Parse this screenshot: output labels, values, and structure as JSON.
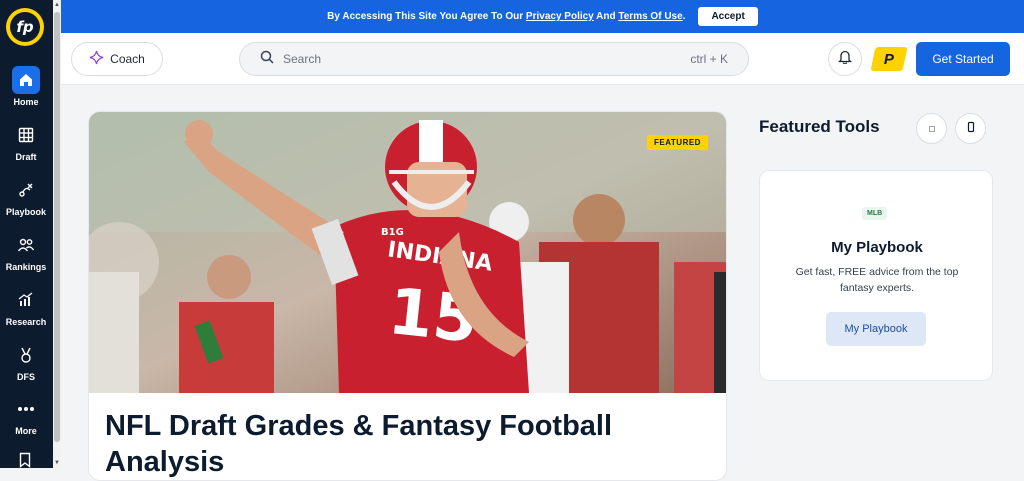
{
  "sidebar": {
    "logo_text": "fp",
    "items": [
      {
        "label": "Home",
        "icon": "home-icon",
        "active": true
      },
      {
        "label": "Draft",
        "icon": "grid-icon"
      },
      {
        "label": "Playbook",
        "icon": "playbook-icon"
      },
      {
        "label": "Rankings",
        "icon": "users-icon"
      },
      {
        "label": "Research",
        "icon": "chart-icon"
      },
      {
        "label": "DFS",
        "icon": "medal-icon"
      },
      {
        "label": "More",
        "icon": "dots-icon"
      }
    ]
  },
  "banner": {
    "text_prefix": "By Accessing This Site You Agree To Our ",
    "privacy_link": "Privacy Policy",
    "text_middle": " And ",
    "terms_link": "Terms Of Use",
    "text_suffix": ".",
    "accept_label": "Accept"
  },
  "header": {
    "coach_label": "Coach",
    "search_placeholder": "Search",
    "search_shortcut": "ctrl + K",
    "premium_badge": "P",
    "get_started_label": "Get Started"
  },
  "article": {
    "badge": "FEATURED",
    "title": "NFL Draft Grades & Fantasy Football Analysis",
    "jersey_text": "INDIANA",
    "jersey_number": "15",
    "helmet_logo": "B1G"
  },
  "featured_tools": {
    "title": "Featured Tools",
    "card": {
      "tag": "MLB",
      "name": "My Playbook",
      "description": "Get fast, FREE advice from the top fantasy experts.",
      "button_label": "My Playbook"
    }
  },
  "colors": {
    "brand_blue": "#1565e0",
    "sidebar_bg": "#0d1b2e",
    "accent_yellow": "#ffd200"
  }
}
